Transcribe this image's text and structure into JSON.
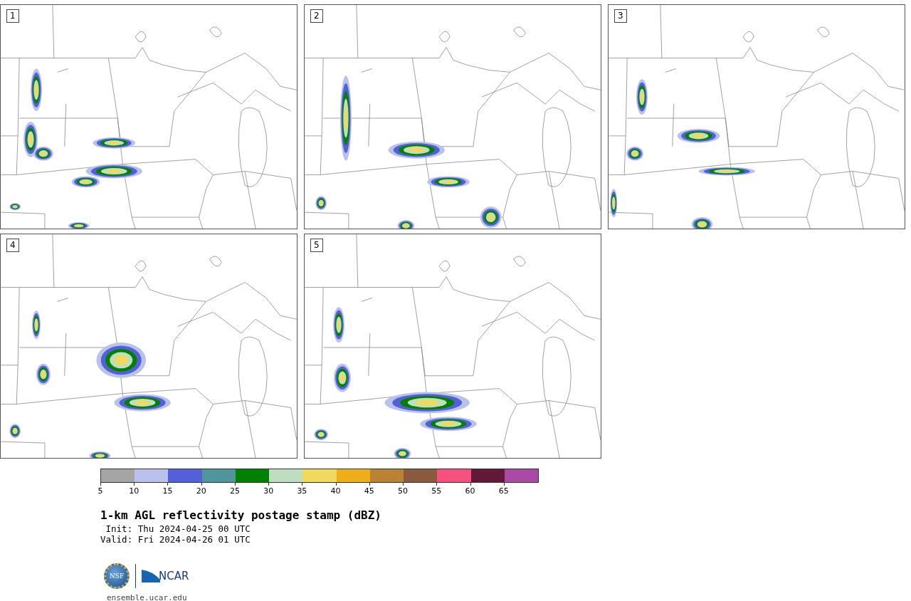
{
  "panels": [
    {
      "number": "1"
    },
    {
      "number": "2"
    },
    {
      "number": "3"
    },
    {
      "number": "4"
    },
    {
      "number": "5"
    }
  ],
  "colorbar": {
    "bins": [
      {
        "color": "#a5a5a5"
      },
      {
        "color": "#b8c2ec"
      },
      {
        "color": "#5360d8"
      },
      {
        "color": "#4e969c"
      },
      {
        "color": "#008200"
      },
      {
        "color": "#bedebf"
      },
      {
        "color": "#f0d95c"
      },
      {
        "color": "#efad18"
      },
      {
        "color": "#ba8232"
      },
      {
        "color": "#8a5a3f"
      },
      {
        "color": "#f5507e"
      },
      {
        "color": "#621837"
      },
      {
        "color": "#ab4aa6"
      }
    ],
    "ticks": [
      "5",
      "10",
      "15",
      "20",
      "25",
      "30",
      "35",
      "40",
      "45",
      "50",
      "55",
      "60",
      "65"
    ]
  },
  "title": "1-km AGL reflectivity postage stamp (dBZ)",
  "init": " Init: Thu 2024-04-25 00 UTC",
  "valid": "Valid: Fri 2024-04-26 01 UTC",
  "logo": {
    "nsf": "NSF",
    "ncar": "NCAR"
  },
  "url": "ensemble.ucar.edu"
}
